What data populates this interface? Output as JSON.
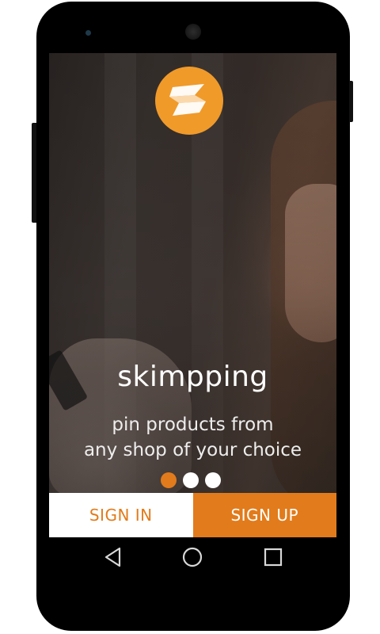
{
  "app": {
    "name": "skimpping",
    "tagline_line1": "pin products from",
    "tagline_line2": "any shop of your choice"
  },
  "logo": {
    "icon": "skimpping-logo-icon",
    "color": "#f09a2a"
  },
  "pager": {
    "count": 3,
    "active_index": 0,
    "active_color": "#e27b1b"
  },
  "buttons": {
    "sign_in": "SIGN IN",
    "sign_up": "SIGN UP",
    "accent": "#e27b1b"
  },
  "navbar": {
    "back_icon": "back-triangle-icon",
    "home_icon": "home-circle-icon",
    "recents_icon": "recents-square-icon"
  }
}
